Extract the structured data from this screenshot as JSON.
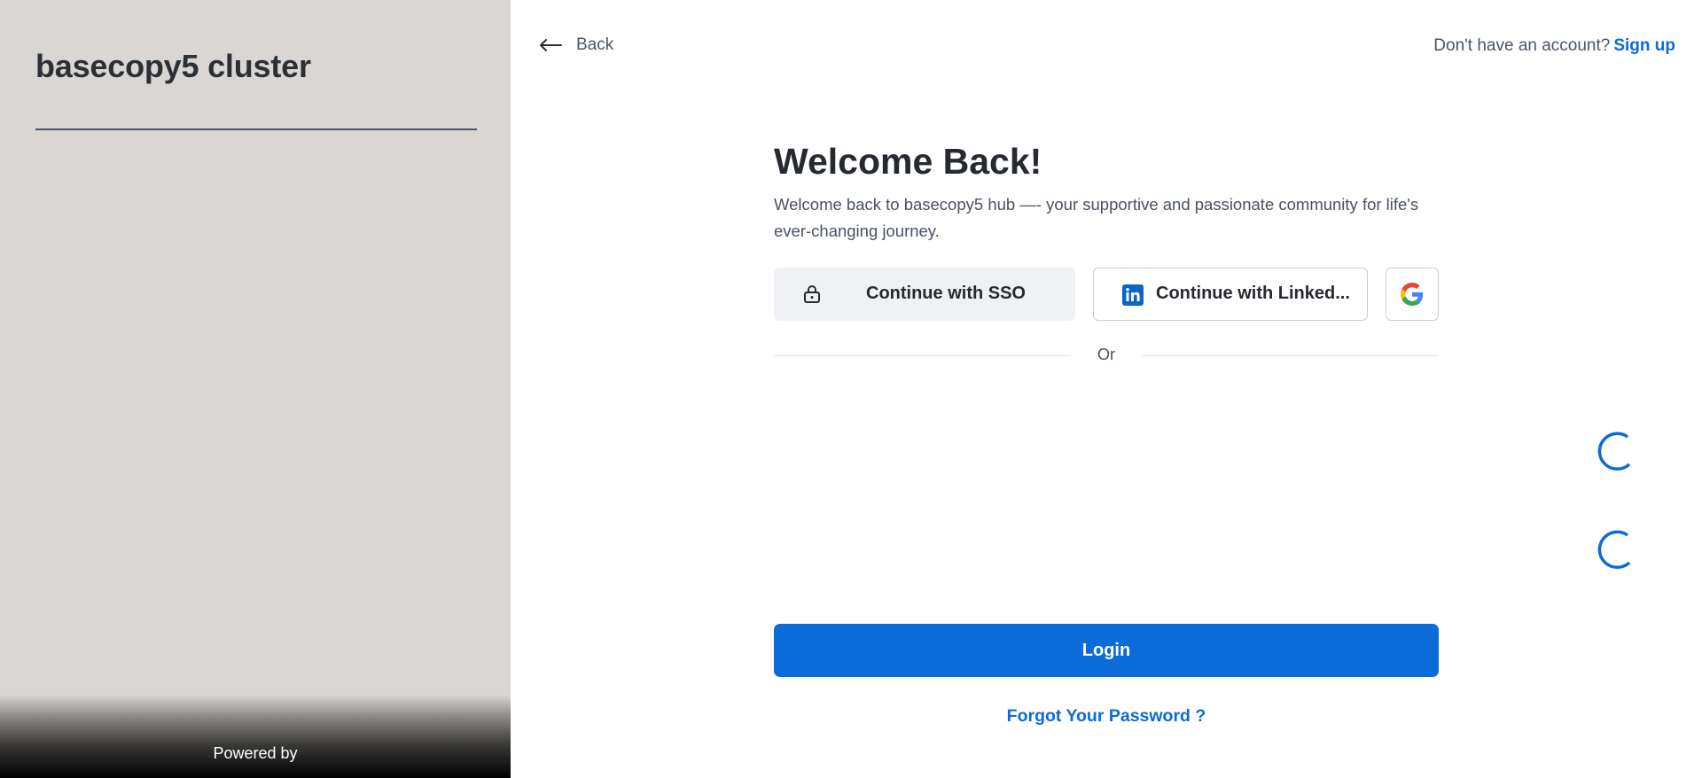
{
  "sidebar": {
    "cluster_title": "basecopy5 cluster",
    "footer_text": "Powered by"
  },
  "header": {
    "back_label": "Back",
    "account_prompt": "Don't have an account?",
    "signup_label": "Sign up"
  },
  "login": {
    "heading": "Welcome Back!",
    "subtitle": "Welcome back to basecopy5 hub —- your supportive and passionate community for life's ever-changing journey.",
    "sso_label": "Continue with SSO",
    "linkedin_label": "Continue with Linked...",
    "or_label": "Or",
    "login_label": "Login",
    "forgot_label": "Forgot Your Password ?"
  },
  "icons": {
    "back": "arrow-left-icon",
    "sso": "lock-icon",
    "linkedin": "linkedin-icon",
    "google": "google-icon",
    "loading": "spinner-icon"
  },
  "colors": {
    "accent": "#0b6bd9",
    "sidebar_bg": "#dad6d3",
    "linkedin_blue": "#0a66c2"
  }
}
